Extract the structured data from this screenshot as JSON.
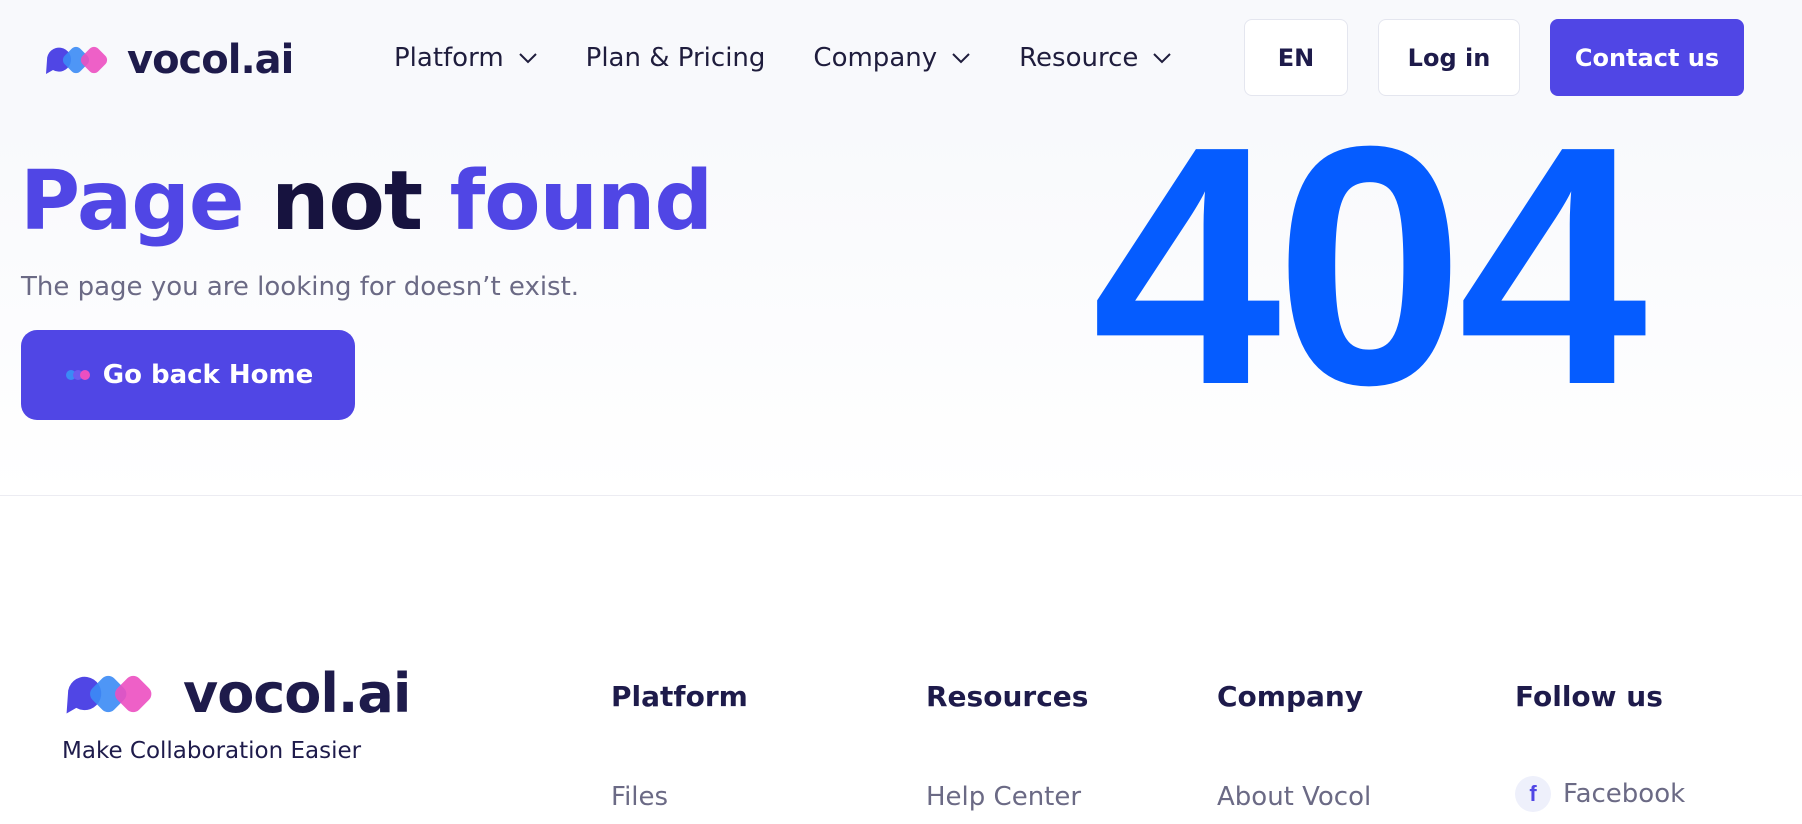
{
  "brand": {
    "name": "vocol.ai",
    "tagline": "Make Collaboration Easier"
  },
  "colors": {
    "accent": "#5046e5",
    "dark": "#1e1b4b",
    "blue404": "#055cff",
    "muted": "#6b6a85"
  },
  "header": {
    "nav": [
      {
        "label": "Platform",
        "has_dropdown": true
      },
      {
        "label": "Plan & Pricing",
        "has_dropdown": false
      },
      {
        "label": "Company",
        "has_dropdown": true
      },
      {
        "label": "Resource",
        "has_dropdown": true
      }
    ],
    "lang_label": "EN",
    "login_label": "Log in",
    "contact_label": "Contact us"
  },
  "hero": {
    "title_part1": "Page",
    "title_part2": "not",
    "title_part3": "found",
    "subtitle": "The page you are looking for doesn’t exist.",
    "home_button": "Go back Home",
    "error_code": "404"
  },
  "footer": {
    "columns": [
      {
        "title": "Platform",
        "first_link": "Files"
      },
      {
        "title": "Resources",
        "first_link": "Help Center"
      },
      {
        "title": "Company",
        "first_link": "About Vocol"
      },
      {
        "title": "Follow us",
        "first_link": "Facebook",
        "icon": "facebook-icon"
      }
    ]
  }
}
